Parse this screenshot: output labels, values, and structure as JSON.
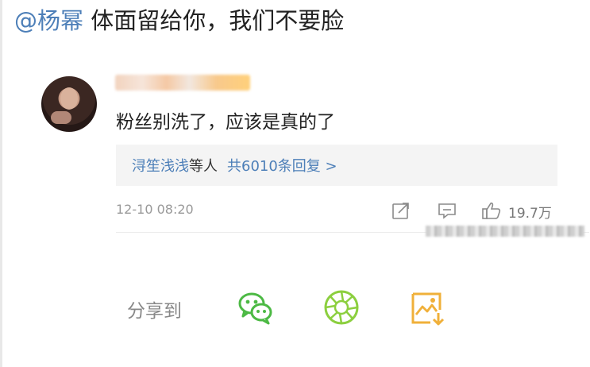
{
  "post": {
    "mention": "@杨幂",
    "text": "体面留给你，我们不要脸"
  },
  "comment": {
    "text": "粉丝别洗了，应该是真的了",
    "replies": {
      "names": "浔笙浅浅",
      "suffix": "等人",
      "count_text": "共6010条回复 >"
    },
    "time": "12-10 08:20",
    "likes": "19.7万"
  },
  "share": {
    "label": "分享到",
    "targets": [
      "wechat-icon",
      "moments-icon",
      "save-image-icon"
    ]
  },
  "colors": {
    "link": "#4d7fb8",
    "wechat_green": "#4cb944",
    "moments_green": "#8ccf3f",
    "save_orange": "#f0b03a"
  }
}
